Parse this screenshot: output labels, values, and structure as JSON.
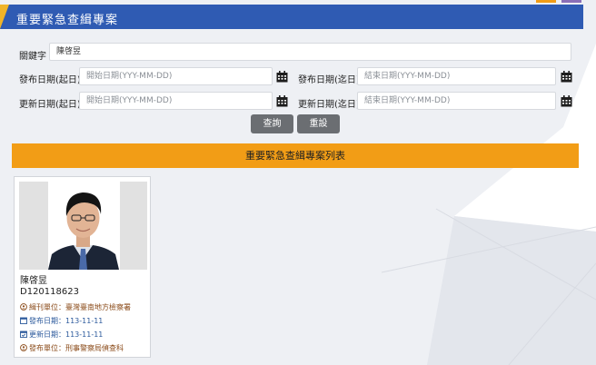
{
  "header": {
    "title": "重要緊急查緝專案"
  },
  "form": {
    "keyword": {
      "label": "關鍵字",
      "value": "陳啓昱"
    },
    "publish_start": {
      "label": "發布日期(起日)",
      "placeholder": "開始日期(YYY-MM-DD)"
    },
    "publish_end": {
      "label": "發布日期(迄日)",
      "placeholder": "結束日期(YYY-MM-DD)"
    },
    "update_start": {
      "label": "更新日期(起日)",
      "placeholder": "開始日期(YYY-MM-DD)"
    },
    "update_end": {
      "label": "更新日期(迄日)",
      "placeholder": "結束日期(YYY-MM-DD)"
    },
    "search_label": "查詢",
    "reset_label": "重設"
  },
  "list": {
    "title": "重要緊急查緝專案列表",
    "items": [
      {
        "name": "陳啓昱",
        "id": "D120118623",
        "issuing_unit": "緝刊單位：臺灣臺南地方檢察署",
        "publish_date": "發布日期：113-11-11",
        "update_date": "更新日期：113-11-11",
        "publisher_unit": "發布單位：刑事警察局偵查科"
      }
    ]
  },
  "colors": {
    "header_bg": "#2f5bb3",
    "accent": "#f29d16",
    "notch": "#f0b429",
    "button": "#6b6e72"
  }
}
